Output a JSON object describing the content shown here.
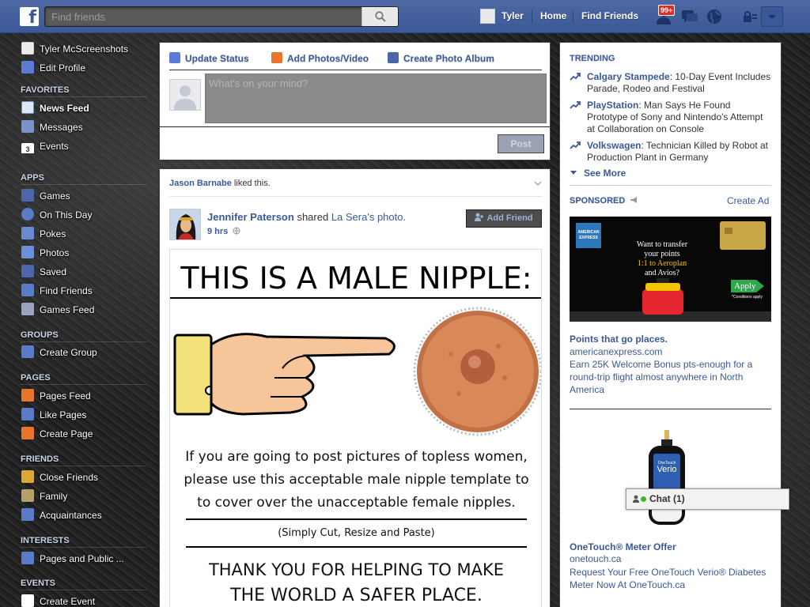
{
  "topbar": {
    "logo": "f",
    "search_placeholder": "Find friends",
    "user_name": "Tyler",
    "home": "Home",
    "find_friends": "Find Friends",
    "notif_badge": "99+"
  },
  "sidebar": {
    "profile": [
      {
        "label": "Tyler McScreenshots",
        "icon": "avatar"
      },
      {
        "label": "Edit Profile",
        "icon": "pencil-icon"
      }
    ],
    "favorites_title": "FAVORITES",
    "favorites": [
      {
        "label": "News Feed",
        "icon": "news-feed-icon"
      },
      {
        "label": "Messages",
        "icon": "messages-icon"
      },
      {
        "label": "Events",
        "icon": "calendar-icon",
        "badge": "3"
      }
    ],
    "apps_title": "APPS",
    "apps": [
      {
        "label": "Games",
        "icon": "games-icon"
      },
      {
        "label": "On This Day",
        "icon": "clock-icon"
      },
      {
        "label": "Pokes",
        "icon": "poke-icon"
      },
      {
        "label": "Photos",
        "icon": "photos-icon"
      },
      {
        "label": "Saved",
        "icon": "bookmark-icon"
      },
      {
        "label": "Find Friends",
        "icon": "friends-icon"
      },
      {
        "label": "Games Feed",
        "icon": "controller-icon"
      }
    ],
    "groups_title": "GROUPS",
    "groups": [
      {
        "label": "Create Group",
        "icon": "plus-icon"
      }
    ],
    "pages_title": "PAGES",
    "pages": [
      {
        "label": "Pages Feed",
        "icon": "flag-icon"
      },
      {
        "label": "Like Pages",
        "icon": "thumb-icon"
      },
      {
        "label": "Create Page",
        "icon": "plus-icon"
      }
    ],
    "friends_title": "FRIENDS",
    "friends": [
      {
        "label": "Close Friends",
        "icon": "star-icon"
      },
      {
        "label": "Family",
        "icon": "house-icon"
      },
      {
        "label": "Acquaintances",
        "icon": "people-icon"
      }
    ],
    "interests_title": "INTERESTS",
    "interests": [
      {
        "label": "Pages and Public ...",
        "icon": "list-icon"
      }
    ],
    "events_title": "EVENTS",
    "events": [
      {
        "label": "Create Event",
        "icon": "plus-icon"
      }
    ]
  },
  "composer": {
    "update_status": "Update Status",
    "add_photos": "Add Photos/Video",
    "create_album": "Create Photo Album",
    "placeholder": "What's on your mind?",
    "post": "Post"
  },
  "story": {
    "liker": "Jason Barnabe",
    "liked_text": " liked this.",
    "author": "Jennifer Paterson",
    "shared_text": " shared ",
    "shared_owner": "La Sera",
    "shared_suffix": "'s photo.",
    "time": "9 hrs",
    "add_friend": "Add Friend",
    "image": {
      "title": "THIS IS A MALE NIPPLE:",
      "line1": "If you are going to post pictures of topless women,",
      "line2": "please use this acceptable male nipple template to",
      "line3": "to cover over the unacceptable female nipples.",
      "instruction": "(Simply Cut, Resize and Paste)",
      "thanks1": "THANK YOU FOR HELPING TO MAKE",
      "thanks2": "THE WORLD A SAFER PLACE."
    }
  },
  "right": {
    "trending_title": "TRENDING",
    "trends": [
      {
        "topic": "Calgary Stampede",
        "text": ": 10-Day Event Includes Parade, Rodeo and Festival"
      },
      {
        "topic": "PlayStation",
        "text": ": Man Says He Found Prototype of Sony and Nintendo's Attempt at Collaboration on Console"
      },
      {
        "topic": "Volkswagen",
        "text": ": Technician Killed by Robot at Production Plant in Germany"
      }
    ],
    "see_more": "See More",
    "sponsored_title": "SPONSORED",
    "create_ad": "Create Ad",
    "ad1": {
      "title": "Points that go places.",
      "domain": "americanexpress.com",
      "desc": "Earn 25K Welcome Bonus pts-enough for a round-trip flight almost anywhere in North America",
      "img_text1": "Want to transfer",
      "img_text2": "your points",
      "img_text3": "1:1 to Aeroplan",
      "img_text4": "and Avios?",
      "img_apply": "Apply",
      "img_conditions": "*Conditions apply",
      "img_brand1": "AMERICAN",
      "img_brand2": "EXPRESS"
    },
    "ad2": {
      "title": "OneTouch® Meter Offer",
      "domain": "onetouch.ca",
      "desc": "Request Your Free OneTouch Verio® Diabetes Meter Now At OneTouch.ca",
      "device_brand": "OneTouch",
      "device_name": "Verio"
    }
  },
  "chat": {
    "label": "Chat (1)"
  }
}
